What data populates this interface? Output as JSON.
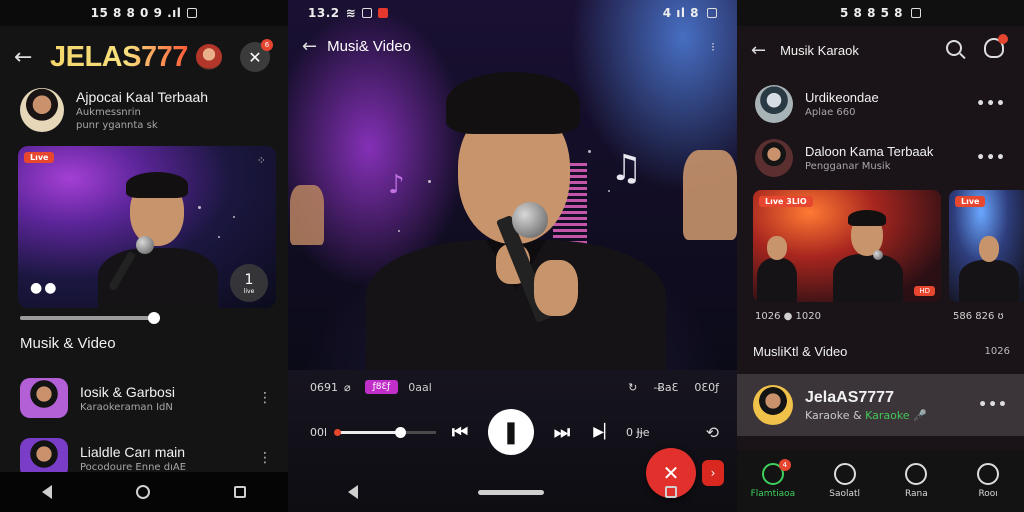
{
  "status": {
    "p1": "15 8 8 0 9 .ıl ",
    "p2_time": "13.2",
    "p2_right": "4 ıl 8",
    "p3": "5 8 8 5 8"
  },
  "panel1": {
    "brand": "JELAS777",
    "header_badge": "6",
    "profile": {
      "title": "Ajpocai Kaal Terbaah",
      "sub1": "Aukmessnrin",
      "sub2": "punr ygannta sk"
    },
    "thumb": {
      "chip": "Lıve",
      "dots": "●●",
      "counter": "1",
      "counter_sub": "live"
    },
    "progress": 0.96,
    "section_title": "Musik & Video",
    "list": [
      {
        "title": "Iosik & Garbosi",
        "sub": "Karaokeraman IdN"
      },
      {
        "title": "Lialdle Carı main",
        "sub": "Pocodoure Enne dıAE"
      }
    ]
  },
  "panel2": {
    "title": "Musi& Video",
    "time_left": "0691",
    "chip": "ƒ8Ɛƒ",
    "mid": "0aal",
    "right1": "-ɃaƐ",
    "right2": "0Ɛ0ƒ",
    "time_cur": "00l",
    "time_end": "0 Ɉɉe",
    "progress": 0.64
  },
  "panel3": {
    "title": "Musik Karaok",
    "rows": [
      {
        "title": "Urdikeondae",
        "sub": "Aplae 660"
      },
      {
        "title": "Daloon Kama Terbaak",
        "sub": "Pengganar Musik"
      }
    ],
    "card1": {
      "chip": "Lıve 3LIO",
      "meta": "1026 ● 1020"
    },
    "card2": {
      "chip": "Lıve",
      "meta": "586 826 ʊ"
    },
    "section_title": "MusliKtl & Video",
    "section_count": "1026",
    "active": {
      "title": "JelaAS7777",
      "sub_a": "Karaoke & ",
      "sub_b": "Karaoke"
    },
    "tabs": [
      {
        "label": "Flamtiaoa",
        "active": true,
        "badge": "4"
      },
      {
        "label": "Saolatl",
        "active": false
      },
      {
        "label": "Rana",
        "active": false
      },
      {
        "label": "Rooı",
        "active": false
      }
    ]
  },
  "colors": {
    "accent_red": "#e5392f",
    "accent_green": "#3ecf5c",
    "brand_gold": "#f5d66b",
    "chip_pink": "#c030c8"
  }
}
